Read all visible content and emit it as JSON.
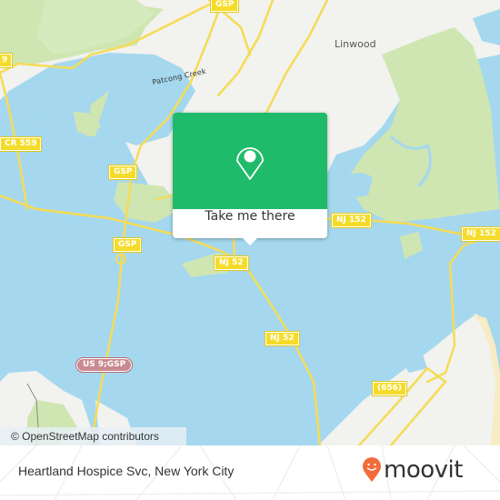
{
  "map": {
    "place_labels": [
      {
        "id": "linwood",
        "text": "Linwood"
      }
    ],
    "water_labels": [
      {
        "id": "patcong-creek",
        "text": "Patcong Creek"
      }
    ],
    "route_shields": [
      {
        "id": "gsp-top",
        "text": "GSP",
        "kind": "state"
      },
      {
        "id": "cr559-left-edge",
        "text": "9",
        "kind": "state"
      },
      {
        "id": "cr559",
        "text": "CR 559",
        "kind": "state"
      },
      {
        "id": "gsp-mid",
        "text": "GSP",
        "kind": "state"
      },
      {
        "id": "gsp-lower",
        "text": "GSP",
        "kind": "state"
      },
      {
        "id": "nj52-a",
        "text": "NJ 52",
        "kind": "state"
      },
      {
        "id": "nj52-b",
        "text": "NJ 52",
        "kind": "state"
      },
      {
        "id": "nj152-a",
        "text": "NJ 152",
        "kind": "state"
      },
      {
        "id": "nj152-b",
        "text": "NJ 152",
        "kind": "state"
      },
      {
        "id": "us9gsp",
        "text": "US 9;GSP",
        "kind": "us"
      },
      {
        "id": "cr656",
        "text": "(656)",
        "kind": "state"
      }
    ],
    "colors": {
      "water": "#a5d8ee",
      "land": "#f2f2ef",
      "green": "#cfe6b2",
      "road": "#f5dc55",
      "sand": "#f7ecc4"
    }
  },
  "popup": {
    "icon": "map-pin-icon",
    "cta_label": "Take me there",
    "accent": "#20bb6a"
  },
  "attribution": "© OpenStreetMap contributors",
  "footer": {
    "place_name": "Heartland Hospice Svc, New York City",
    "logo_text": "moovit",
    "logo_color": "#f26b3a"
  }
}
